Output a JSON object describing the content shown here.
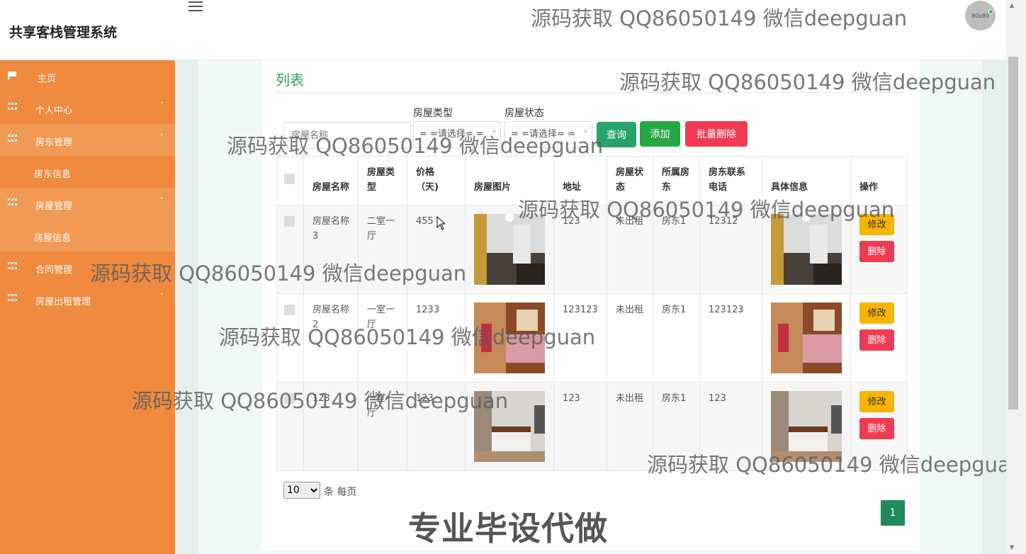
{
  "header": {
    "brand": "共享客栈管理系统",
    "avatar_text": "80x80"
  },
  "sidebar": {
    "items": [
      {
        "label": "主页",
        "icon": "flag-icon"
      },
      {
        "label": "个人中心",
        "icon": "grid-icon",
        "caret": "˅"
      },
      {
        "label": "房东管理",
        "icon": "grid-icon",
        "caret": "˄",
        "active": true
      },
      {
        "label": "房东信息",
        "sub": true
      },
      {
        "label": "房屋管理",
        "icon": "grid-icon",
        "caret": "˄",
        "active": true
      },
      {
        "label": "房屋信息",
        "sub": true
      },
      {
        "label": "合同管理",
        "icon": "grid-icon"
      },
      {
        "label": "房屋出租管理",
        "icon": "grid-icon",
        "caret": "˅"
      }
    ]
  },
  "main": {
    "title": "列表",
    "search": {
      "placeholder": "房屋名称",
      "type_label": "房屋类型",
      "type_value": "= =请选择= =",
      "status_label": "房屋状态",
      "status_value": "= =请选择= ="
    },
    "buttons": {
      "query": "查询",
      "add": "添加",
      "batch_delete": "批量删除"
    },
    "table": {
      "headers": {
        "name": "房屋名称",
        "type": "房屋类型",
        "price": "价格（天)",
        "image": "房屋图片",
        "address": "地址",
        "status": "房屋状态",
        "owner": "所属房东",
        "phone": "房东联系电话",
        "detail": "具体信息",
        "ops": "操作"
      },
      "rows": [
        {
          "name": "房屋名称3",
          "type": "二室一厅",
          "price": "455",
          "address": "123",
          "status": "未出租",
          "owner": "房东1",
          "phone": "12312"
        },
        {
          "name": "房屋名称2",
          "type": "一室一厅",
          "price": "1233",
          "address": "123123",
          "status": "未出租",
          "owner": "房东1",
          "phone": "123123"
        },
        {
          "name": "123",
          "type": "一室一厅",
          "price": "123",
          "address": "123",
          "status": "未出租",
          "owner": "房东1",
          "phone": "123"
        }
      ],
      "edit_label": "修改",
      "delete_label": "删除"
    },
    "paging": {
      "page_size": "10",
      "page_size_label": "条 每页",
      "current_page": "1"
    }
  },
  "watermarks": {
    "text": "源码获取 QQ86050149 微信deepguan",
    "promo": "专业毕设代做"
  }
}
